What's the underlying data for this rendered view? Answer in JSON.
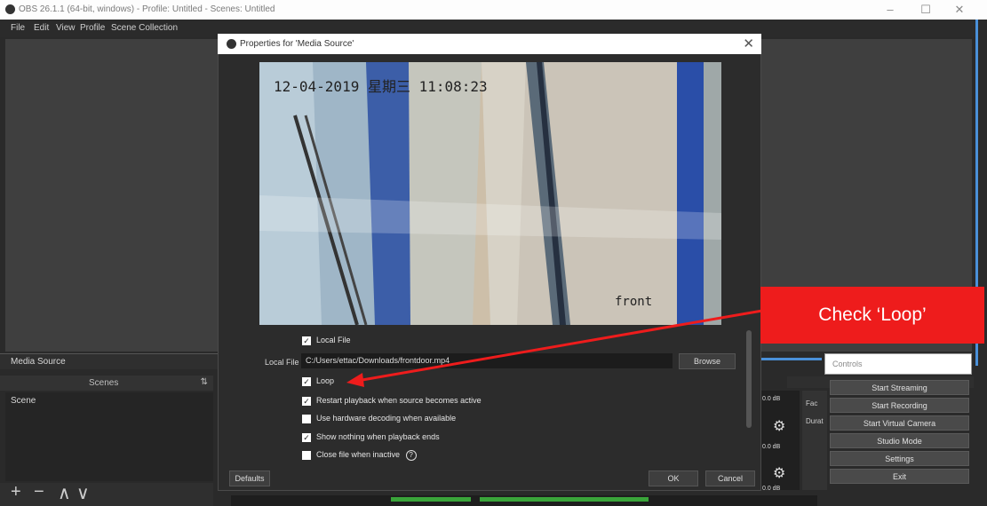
{
  "window": {
    "title": "OBS 26.1.1 (64-bit, windows) - Profile: Untitled - Scenes: Untitled",
    "minimize_glyph": "–",
    "maximize_glyph": "☐",
    "close_glyph": "✕"
  },
  "menu": [
    "File",
    "Edit",
    "View",
    "Profile",
    "Scene Collection"
  ],
  "sources_dock": {
    "title": "Media Source"
  },
  "scenes_dock": {
    "header": "Scenes",
    "items": [
      "Scene"
    ],
    "footer": [
      "+",
      "−",
      "∧",
      "∨"
    ]
  },
  "dialog": {
    "title": "Properties for 'Media Source'",
    "close_glyph": "✕",
    "video": {
      "timestamp": "12-04-2019 星期三 11:08:23",
      "camera_label": "front"
    },
    "local_file_checkbox": {
      "label": "Local File",
      "checked": true
    },
    "local_file_label": "Local File",
    "local_file_path": "C:/Users/ettac/Downloads/frontdoor.mp4",
    "browse_label": "Browse",
    "options": [
      {
        "label": "Loop",
        "checked": true
      },
      {
        "label": "Restart playback when source becomes active",
        "checked": true
      },
      {
        "label": "Use hardware decoding when available",
        "checked": false
      },
      {
        "label": "Show nothing when playback ends",
        "checked": true
      },
      {
        "label": "Close file when inactive",
        "checked": false
      }
    ],
    "defaults_label": "Defaults",
    "ok_label": "OK",
    "cancel_label": "Cancel"
  },
  "mixer": {
    "db_readout": "0.0 dB"
  },
  "transitions": {
    "labels": [
      "Fac",
      "Durat"
    ]
  },
  "controls": {
    "title": "Controls",
    "buttons": [
      "Start Streaming",
      "Start Recording",
      "Start Virtual Camera",
      "Studio Mode",
      "Settings",
      "Exit"
    ]
  },
  "annotation": {
    "text": "Check ‘Loop’",
    "color": "#ee1c1c"
  },
  "colors": {
    "accent": "#4a90d9",
    "background": "#2a2a2a"
  }
}
